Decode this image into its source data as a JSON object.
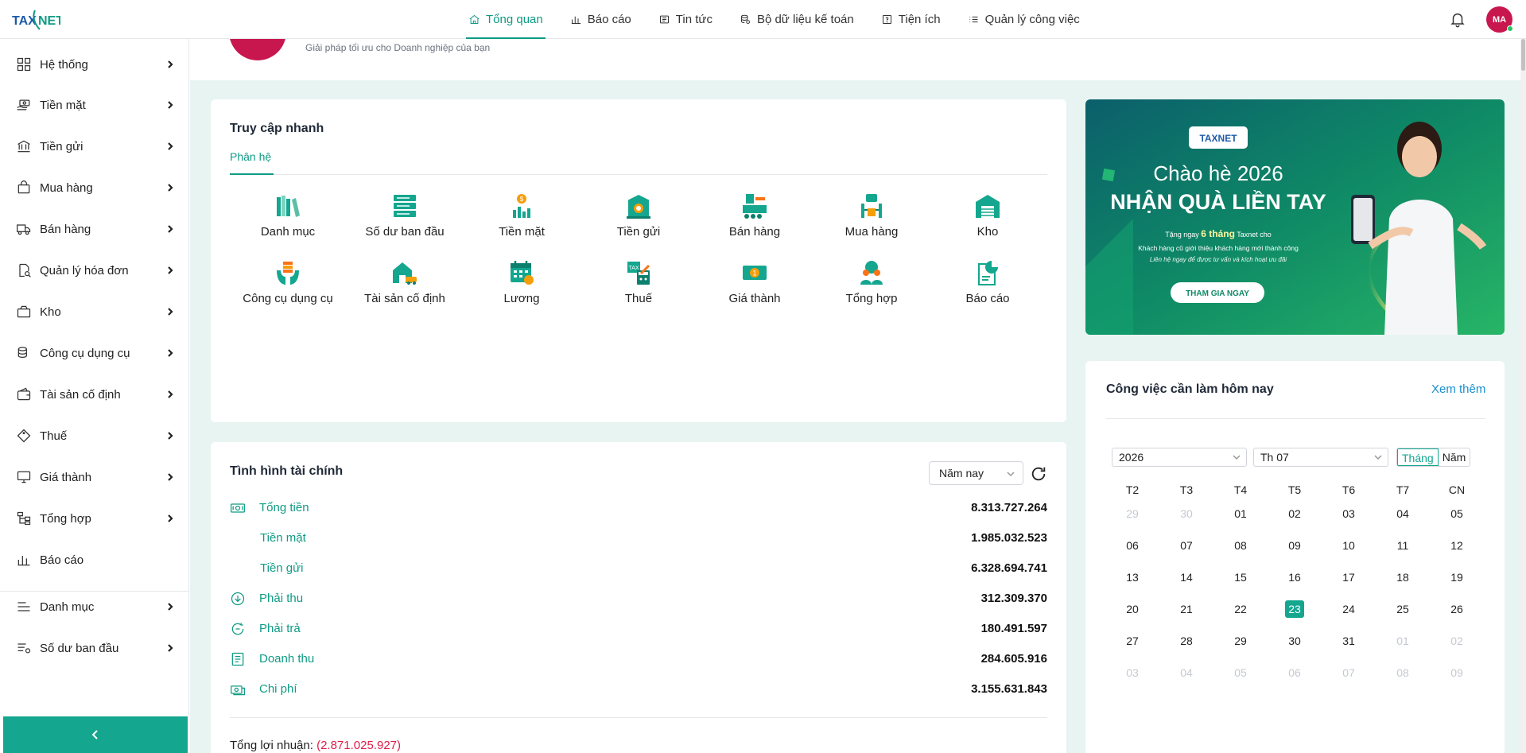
{
  "header": {
    "nav": [
      {
        "label": "Tổng quan",
        "icon": "home-icon",
        "active": true
      },
      {
        "label": "Báo cáo",
        "icon": "bar-chart-icon"
      },
      {
        "label": "Tin tức",
        "icon": "newspaper-icon"
      },
      {
        "label": "Bộ dữ liệu kế toán",
        "icon": "database-icon"
      },
      {
        "label": "Tiện ích",
        "icon": "help-square-icon"
      },
      {
        "label": "Quản lý công việc",
        "icon": "list-icon"
      }
    ],
    "avatar_initials": "MA"
  },
  "sidebar": {
    "items": [
      {
        "label": "Hệ thống",
        "icon": "grid-icon"
      },
      {
        "label": "Tiền mặt",
        "icon": "cash-hand-icon"
      },
      {
        "label": "Tiền gửi",
        "icon": "bank-icon"
      },
      {
        "label": "Mua hàng",
        "icon": "shopping-bag-icon"
      },
      {
        "label": "Bán hàng",
        "icon": "truck-icon"
      },
      {
        "label": "Quản lý hóa đơn",
        "icon": "invoice-search-icon"
      },
      {
        "label": "Kho",
        "icon": "box-icon"
      },
      {
        "label": "Công cụ dụng cụ",
        "icon": "tools-stack-icon"
      },
      {
        "label": "Tài sản cố định",
        "icon": "wallet-icon"
      },
      {
        "label": "Thuế",
        "icon": "tag-icon"
      },
      {
        "label": "Giá thành",
        "icon": "monitor-icon"
      },
      {
        "label": "Tổng hợp",
        "icon": "hierarchy-icon"
      },
      {
        "label": "Báo cáo",
        "icon": "bar-chart-icon"
      },
      {
        "label": "Danh mục",
        "icon": "menu-lines-icon"
      },
      {
        "label": "Số dư ban đầu",
        "icon": "list-settings-icon"
      }
    ]
  },
  "hero": {
    "subtitle": "Giải pháp tối ưu cho Doanh nghiệp của bạn"
  },
  "quick_access": {
    "title": "Truy cập nhanh",
    "tab": "Phân hệ",
    "modules": [
      {
        "label": "Danh mục",
        "icon": "books-icon"
      },
      {
        "label": "Số dư ban đầu",
        "icon": "server-stack-icon"
      },
      {
        "label": "Tiền mặt",
        "icon": "coin-growth-icon"
      },
      {
        "label": "Tiền gửi",
        "icon": "bank-safe-icon"
      },
      {
        "label": "Bán hàng",
        "icon": "sales-counter-icon"
      },
      {
        "label": "Mua hàng",
        "icon": "purchase-icon"
      },
      {
        "label": "Kho",
        "icon": "warehouse-icon"
      },
      {
        "label": "Công cụ dụng cụ",
        "icon": "hands-tools-icon"
      },
      {
        "label": "Tài sản cố định",
        "icon": "house-car-icon"
      },
      {
        "label": "Lương",
        "icon": "calendar-salary-icon"
      },
      {
        "label": "Thuế",
        "icon": "tax-calculator-icon"
      },
      {
        "label": "Giá thành",
        "icon": "banknote-icon"
      },
      {
        "label": "Tổng hợp",
        "icon": "team-icon"
      },
      {
        "label": "Báo cáo",
        "icon": "report-pie-icon"
      }
    ]
  },
  "finance": {
    "title": "Tình hình tài chính",
    "period": "Năm nay",
    "rows": [
      {
        "label": "Tổng tiền",
        "value": "8.313.727.264",
        "icon": "money-icon"
      },
      {
        "label": "Tiền mặt",
        "value": "1.985.032.523",
        "icon": ""
      },
      {
        "label": "Tiền gửi",
        "value": "6.328.694.741",
        "icon": ""
      },
      {
        "label": "Phải thu",
        "value": "312.309.370",
        "icon": "arrow-down-circle-icon"
      },
      {
        "label": "Phải trả",
        "value": "180.491.597",
        "icon": "cycle-icon"
      },
      {
        "label": "Doanh thu",
        "value": "284.605.916",
        "icon": "document-lines-icon"
      },
      {
        "label": "Chi phí",
        "value": "3.155.631.843",
        "icon": "cash-outflow-icon"
      }
    ],
    "profit_label": "Tổng lợi nhuận:",
    "profit_value": "(2.871.025.927)"
  },
  "banner": {
    "logo_text": "TAXNET",
    "line1": "Chào hè 2026",
    "line2": "NHẬN QUÀ LIỀN TAY",
    "offer_prefix": "Tặng ngay ",
    "offer_highlight": "6 tháng",
    "offer_suffix": " Taxnet cho",
    "desc1": "Khách hàng cũ giới thiệu khách hàng mới thành công",
    "desc2": "Liên hệ ngay để được tư vấn và kích hoạt ưu đãi",
    "cta": "THAM GIA NGAY"
  },
  "tasks": {
    "title": "Công việc cần làm hôm nay",
    "more": "Xem thêm",
    "year": "2026",
    "month": "Th 07",
    "toggle_month": "Tháng",
    "toggle_year": "Năm",
    "weekdays": [
      "T2",
      "T3",
      "T4",
      "T5",
      "T6",
      "T7",
      "CN"
    ],
    "weeks": [
      [
        "29",
        "30",
        "01",
        "02",
        "03",
        "04",
        "05"
      ],
      [
        "06",
        "07",
        "08",
        "09",
        "10",
        "11",
        "12"
      ],
      [
        "13",
        "14",
        "15",
        "16",
        "17",
        "18",
        "19"
      ],
      [
        "20",
        "21",
        "22",
        "23",
        "24",
        "25",
        "26"
      ],
      [
        "27",
        "28",
        "29",
        "30",
        "31",
        "01",
        "02"
      ],
      [
        "03",
        "04",
        "05",
        "06",
        "07",
        "08",
        "09"
      ]
    ],
    "today": "23"
  },
  "colors": {
    "accent": "#14a68f",
    "accent_text": "#0f9b84",
    "brand_red": "#c8174f",
    "negative": "#e11d48",
    "link": "#1a8fd1"
  }
}
